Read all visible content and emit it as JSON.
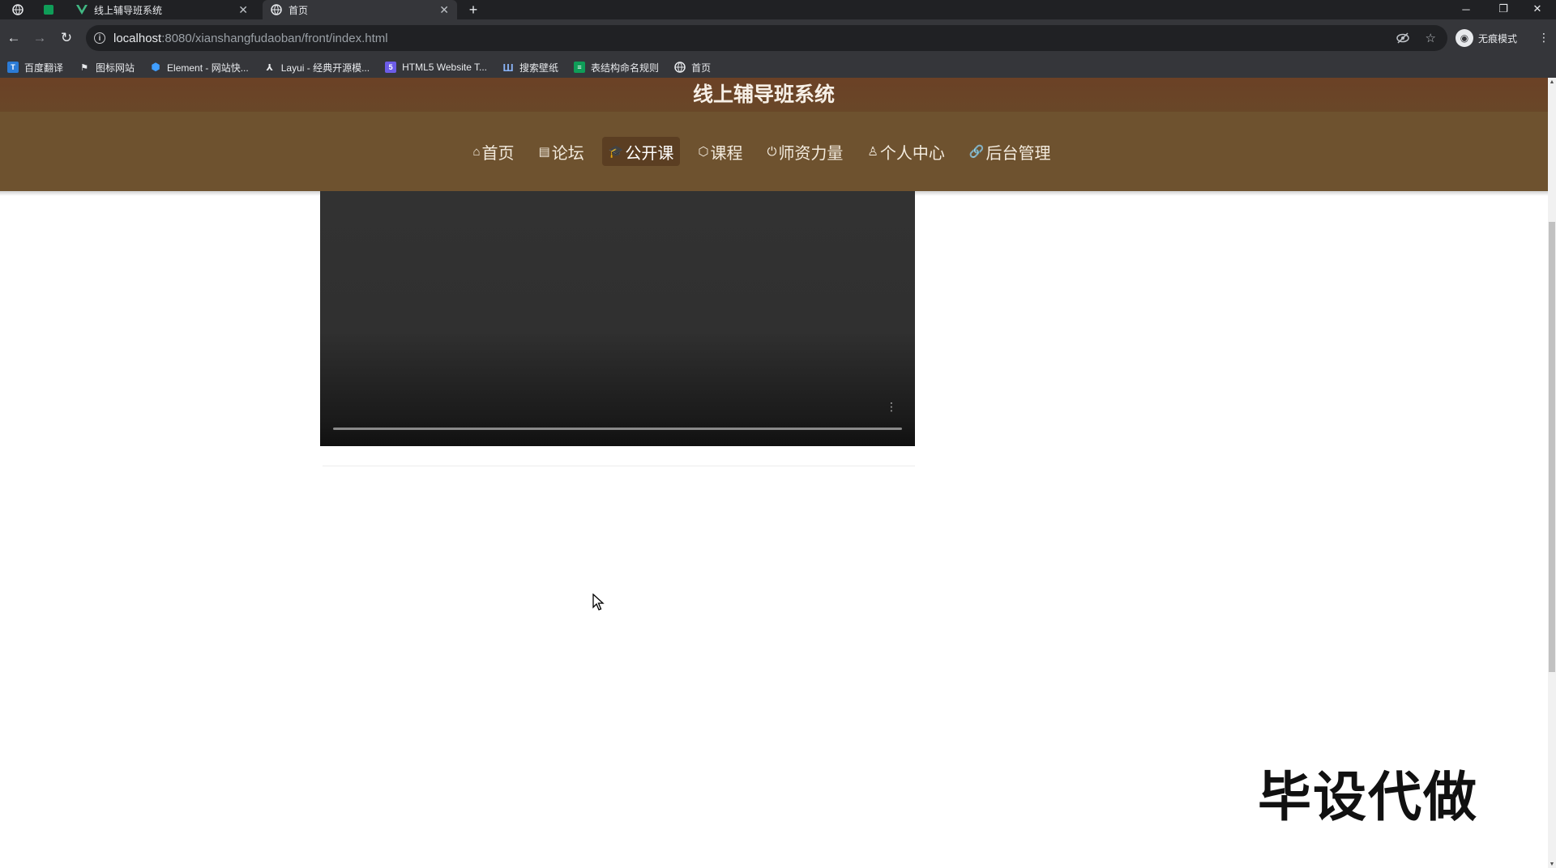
{
  "browser": {
    "tabs": [
      {
        "title": "线上辅导班系统",
        "close": "✕",
        "active": false
      },
      {
        "title": "首页",
        "close": "✕",
        "active": true
      }
    ],
    "new_tab": "+",
    "window_controls": {
      "minimize": "─",
      "restore": "❐",
      "close": "✕"
    },
    "address": {
      "host": "localhost",
      "path": ":8080/xianshangfudaoban/front/index.html"
    },
    "profile_label": "无痕模式",
    "bookmarks": [
      {
        "label": "百度翻译",
        "icon": "translate-icon",
        "color": "#2b7bd6"
      },
      {
        "label": "图标网站",
        "icon": "flag-icon",
        "color": "#35363a"
      },
      {
        "label": "Element - 网站快...",
        "icon": "element-icon",
        "color": "#409eff"
      },
      {
        "label": "Layui - 经典开源模...",
        "icon": "layui-icon",
        "color": "#35363a"
      },
      {
        "label": "HTML5 Website T...",
        "icon": "html5-icon",
        "color": "#6c5ce7"
      },
      {
        "label": "搜索壁纸",
        "icon": "wallpaper-icon",
        "color": "#3b5fd9"
      },
      {
        "label": "表结构命名规则",
        "icon": "sheet-icon",
        "color": "#0f9d58"
      },
      {
        "label": "首页",
        "icon": "globe-icon",
        "color": "#35363a"
      }
    ]
  },
  "site": {
    "title": "线上辅导班系统",
    "nav": [
      {
        "label": "首页",
        "icon": "home-icon",
        "glyph": "⌂",
        "active": false
      },
      {
        "label": "论坛",
        "icon": "forum-icon",
        "glyph": "▤",
        "active": false
      },
      {
        "label": "公开课",
        "icon": "graduation-cap-icon",
        "glyph": "🎓",
        "active": true
      },
      {
        "label": "课程",
        "icon": "course-icon",
        "glyph": "⬡",
        "active": false
      },
      {
        "label": "师资力量",
        "icon": "power-icon",
        "glyph": "⏻",
        "active": false
      },
      {
        "label": "个人中心",
        "icon": "user-icon",
        "glyph": "♙",
        "active": false
      },
      {
        "label": "后台管理",
        "icon": "link-icon",
        "glyph": "🔗",
        "active": false
      }
    ],
    "video": {
      "menu_glyph": "⋮",
      "progress": 0
    }
  },
  "overlay": {
    "watermark": "毕设代做"
  },
  "colors": {
    "brand_brown": "#6e522f",
    "title_band": "#6b4126",
    "active_nav": "#5b3e22"
  }
}
